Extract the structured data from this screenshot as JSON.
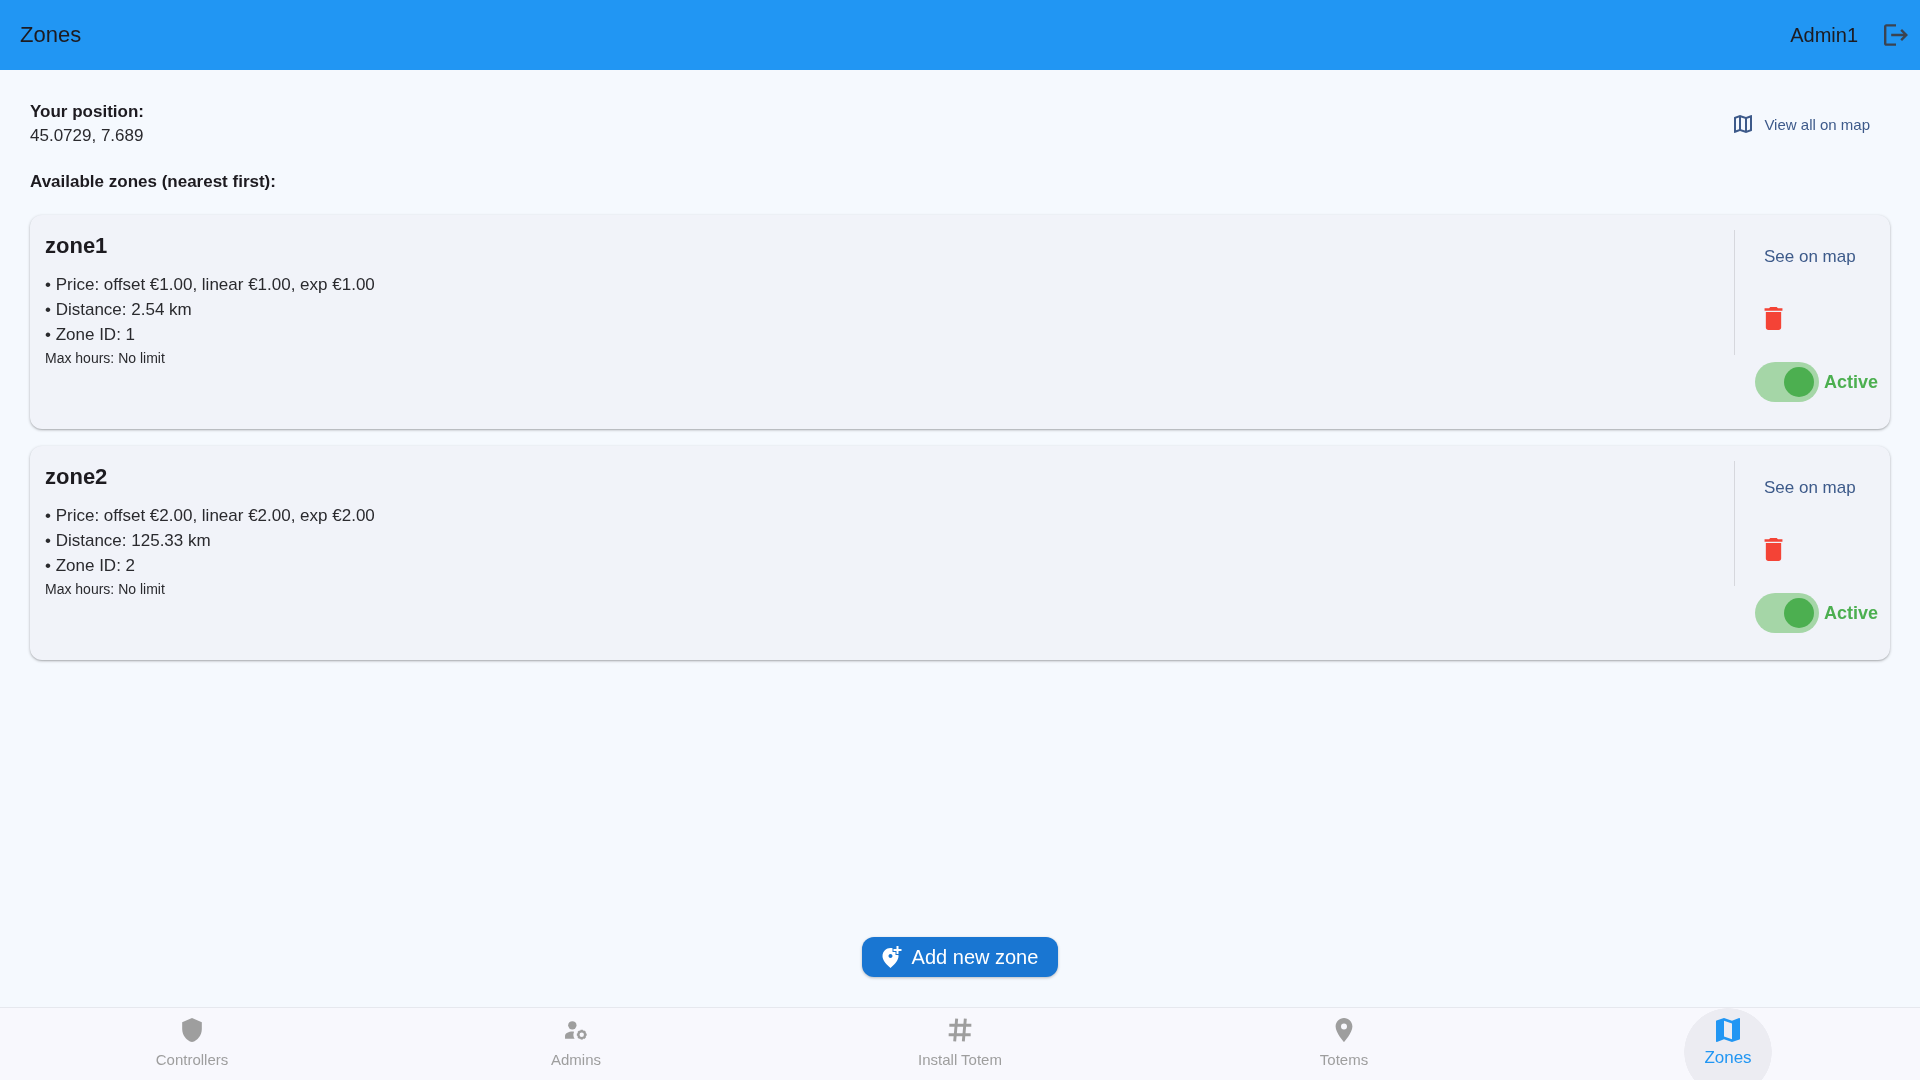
{
  "app_bar": {
    "title": "Zones",
    "user": "Admin1"
  },
  "position": {
    "label": "Your position:",
    "value": "45.0729, 7.689"
  },
  "view_all_on_map": "View all on map",
  "zones_heading": "Available zones (nearest first):",
  "zones": [
    {
      "name": "zone1",
      "details": [
        "• Price: offset €1.00, linear €1.00, exp €1.00",
        "• Distance: 2.54 km",
        "• Zone ID: 1"
      ],
      "max_hours": "Max hours: No limit",
      "map_link": "See on map",
      "active": true,
      "status": "Active"
    },
    {
      "name": "zone2",
      "details": [
        "• Price: offset €2.00, linear €2.00, exp €2.00",
        "• Distance: 125.33 km",
        "• Zone ID: 2"
      ],
      "max_hours": "Max hours: No limit",
      "map_link": "See on map",
      "active": true,
      "status": "Active"
    }
  ],
  "add_button": "Add new zone",
  "bottom_nav": [
    {
      "label": "Controllers",
      "selected": false
    },
    {
      "label": "Admins",
      "selected": false
    },
    {
      "label": "Install Totem",
      "selected": false
    },
    {
      "label": "Totems",
      "selected": false
    },
    {
      "label": "Zones",
      "selected": true
    }
  ]
}
